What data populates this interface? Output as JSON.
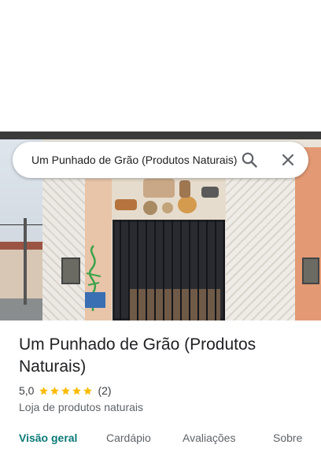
{
  "search": {
    "query": "Um Punhado de Grão (Produtos Naturais)"
  },
  "place": {
    "title": "Um Punhado de Grão (Produtos Naturais)",
    "rating": "5,0",
    "stars": 5,
    "review_count": "(2)",
    "category": "Loja de produtos naturais"
  },
  "tabs": [
    {
      "label": "Visão geral",
      "active": true
    },
    {
      "label": "Cardápio",
      "active": false
    },
    {
      "label": "Avaliações",
      "active": false
    },
    {
      "label": "Sobre",
      "active": false
    }
  ],
  "icons": {
    "search": "search-icon",
    "close": "close-icon",
    "star": "star-icon"
  },
  "colors": {
    "accent": "#0b7a77",
    "star": "#fbbc04",
    "text": "#202124",
    "secondary_text": "#5f6368"
  }
}
